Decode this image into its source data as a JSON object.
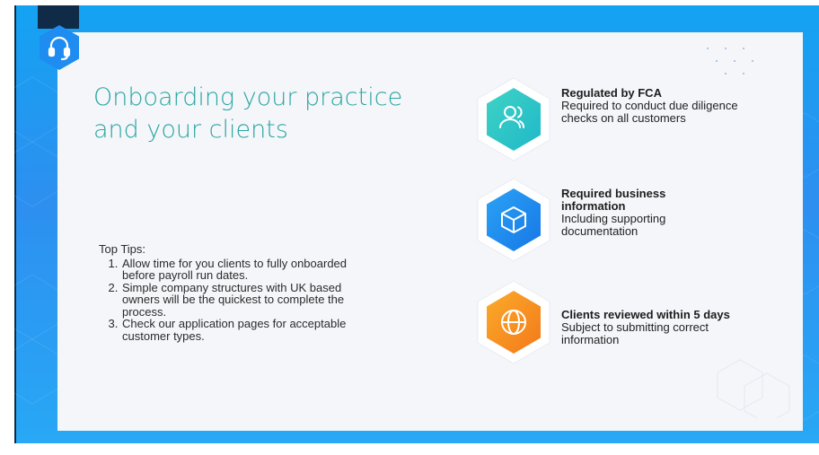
{
  "slide": {
    "title": "Onboarding your practice and your clients",
    "badge_icon": "headset-icon",
    "colors": {
      "background_blue": "#1f9af0",
      "card": "#f5f6fa",
      "title_teal": "#2aa6a2",
      "dark_navy": "#0f2b47"
    }
  },
  "tips": {
    "heading": "Top Tips:",
    "items": [
      "Allow time for you clients to fully onboarded before payroll run dates.",
      "Simple company structures with UK based owners will be the quickest to complete the process.",
      "Check our application pages for acceptable customer types."
    ]
  },
  "features": [
    {
      "icon": "users-icon",
      "color": "#2ec9c0",
      "title": "Regulated by FCA",
      "description": "Required to conduct due diligence checks on all customers"
    },
    {
      "icon": "cube-icon",
      "color": "#1e8cf0",
      "title": "Required business information",
      "description": "Including supporting documentation"
    },
    {
      "icon": "globe-icon",
      "color": "#f7941d",
      "title": "Clients reviewed within 5 days",
      "description": "Subject to submitting correct information"
    }
  ]
}
